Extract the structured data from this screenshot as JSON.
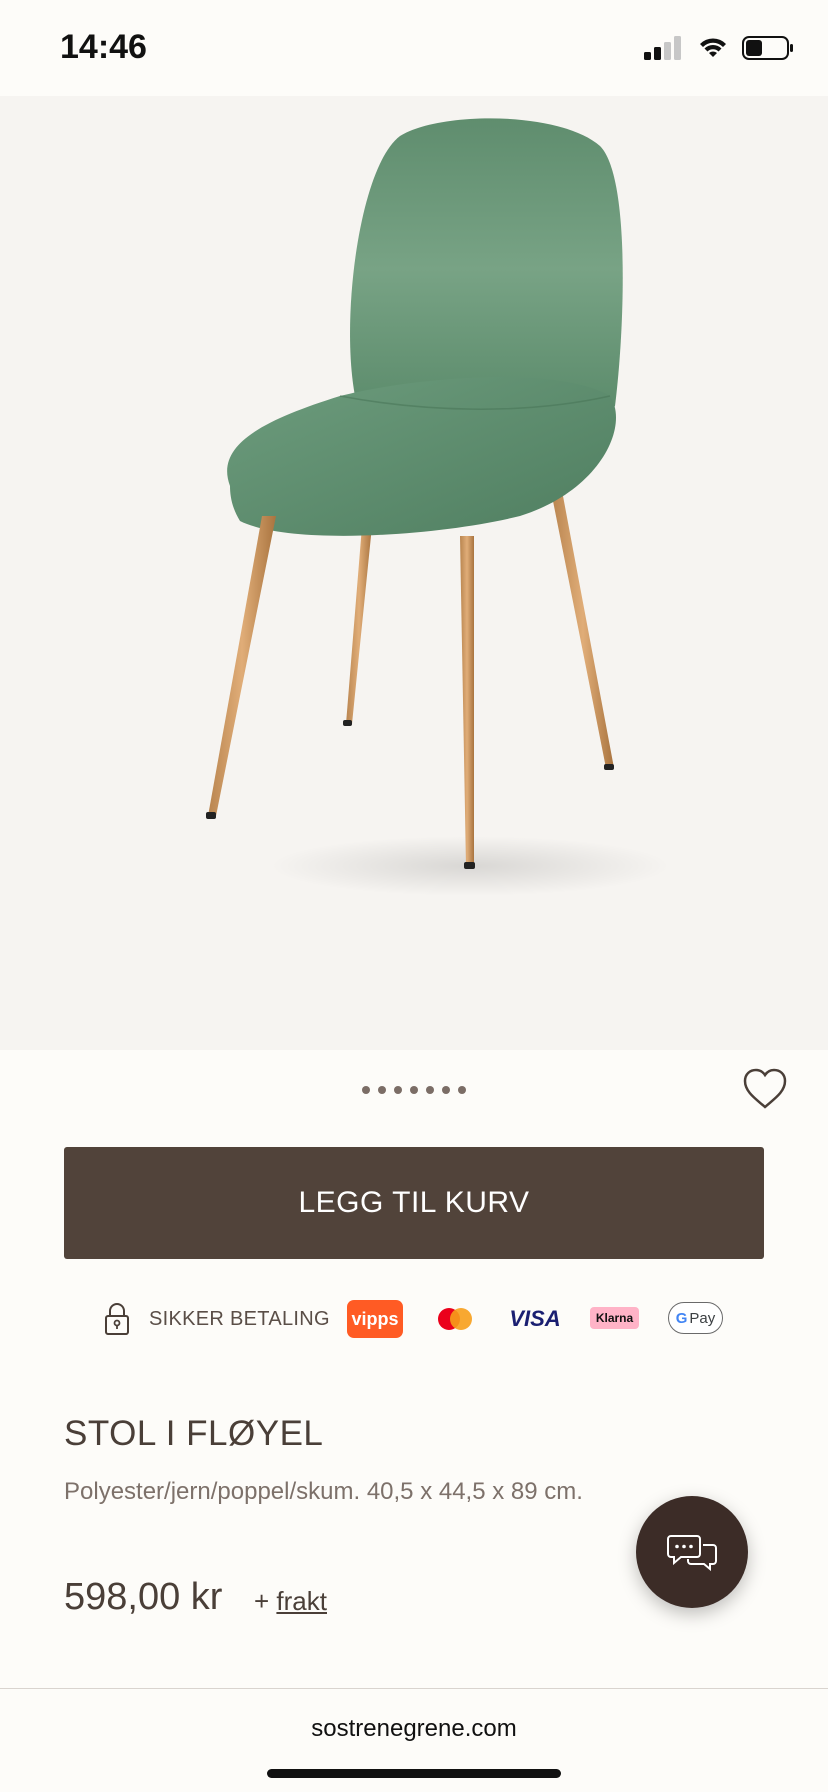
{
  "status_bar": {
    "time": "14:46",
    "battery_level": 0.4
  },
  "product": {
    "image_alt": "Green velvet chair with wooden legs",
    "gallery": {
      "count": 7,
      "active_index": 0
    },
    "add_to_cart_label": "LEGG TIL KURV",
    "title": "STOL I FLØYEL",
    "description": "Polyester/jern/poppel/skum. 40,5 x 44,5 x 89 cm.",
    "price": "598,00 kr",
    "shipping_prefix": "+",
    "shipping_link": "frakt"
  },
  "payment": {
    "label": "SIKKER BETALING",
    "methods": [
      "vipps",
      "VISA",
      "Klarna",
      "Pay"
    ]
  },
  "browser": {
    "url": "sostrenegrene.com"
  },
  "colors": {
    "button": "#51433a",
    "chat": "#3c2c27",
    "background": "#fdfcf9",
    "chair": "#5f8f70"
  }
}
